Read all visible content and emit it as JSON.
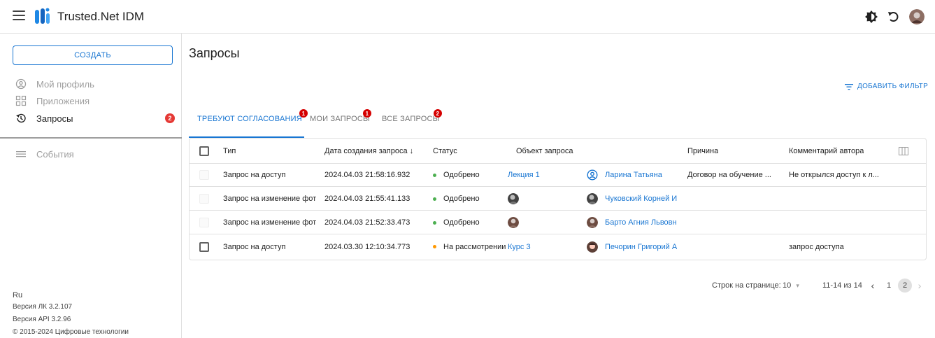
{
  "app": {
    "title": "Trusted.Net IDM"
  },
  "header": {
    "icons": [
      "menu-icon",
      "brightness-icon",
      "refresh-icon",
      "avatar"
    ]
  },
  "sidebar": {
    "create_label": "СОЗДАТЬ",
    "items": [
      {
        "label": "Мой профиль",
        "icon": "account-circle-icon"
      },
      {
        "label": "Приложения",
        "icon": "apps-icon"
      },
      {
        "label": "Запросы",
        "icon": "history-icon",
        "badge": "2",
        "active": true
      },
      {
        "label": "События",
        "icon": "list-icon"
      }
    ],
    "footer": {
      "lang": "Ru",
      "version_lk": "Версия ЛК 3.2.107",
      "version_api": "Версия API 3.2.96",
      "copyright": "© 2015-2024 Цифровые технологии"
    }
  },
  "main": {
    "title": "Запросы",
    "add_filter_label": "ДОБАВИТЬ ФИЛЬТР",
    "tabs": [
      {
        "label": "ТРЕБУЮТ СОГЛАСОВАНИЯ",
        "badge": "1",
        "active": true
      },
      {
        "label": "МОИ ЗАПРОСЫ",
        "badge": "1"
      },
      {
        "label": "ВСЕ ЗАПРОСЫ",
        "badge": "2"
      }
    ],
    "table": {
      "columns": [
        "Тип",
        "Дата создания запроса ↓",
        "Статус",
        "Объект запроса",
        "Причина",
        "Комментарий автора"
      ],
      "rows": [
        {
          "type": "Запрос на доступ",
          "date": "2024.04.03 21:58:16.932",
          "status": "Одобрено",
          "status_color": "#4caf50",
          "object": "Лекция 1",
          "user": "Ларина Татьяна",
          "reason": "Договор на обучение ...",
          "comment": "Не открылся доступ к л..."
        },
        {
          "type": "Запрос на изменение фот",
          "date": "2024.04.03 21:55:41.133",
          "status": "Одобрено",
          "status_color": "#4caf50",
          "object": "",
          "user": "Чуковский Корней И",
          "reason": "",
          "comment": ""
        },
        {
          "type": "Запрос на изменение фот",
          "date": "2024.04.03 21:52:33.473",
          "status": "Одобрено",
          "status_color": "#4caf50",
          "object": "",
          "user": "Барто Агния Львовн",
          "reason": "",
          "comment": ""
        },
        {
          "type": "Запрос на доступ",
          "date": "2024.03.30 12:10:34.773",
          "status": "На рассмотрении",
          "status_color": "#ff9800",
          "object": "Курс 3",
          "user": "Печорин Григорий А",
          "reason": "",
          "comment": "запрос доступа"
        }
      ]
    },
    "pagination": {
      "rows_label": "Строк на странице:",
      "rows_value": "10",
      "range": "11-14 из 14",
      "pages": [
        "1",
        "2"
      ],
      "current_page": "2"
    }
  }
}
